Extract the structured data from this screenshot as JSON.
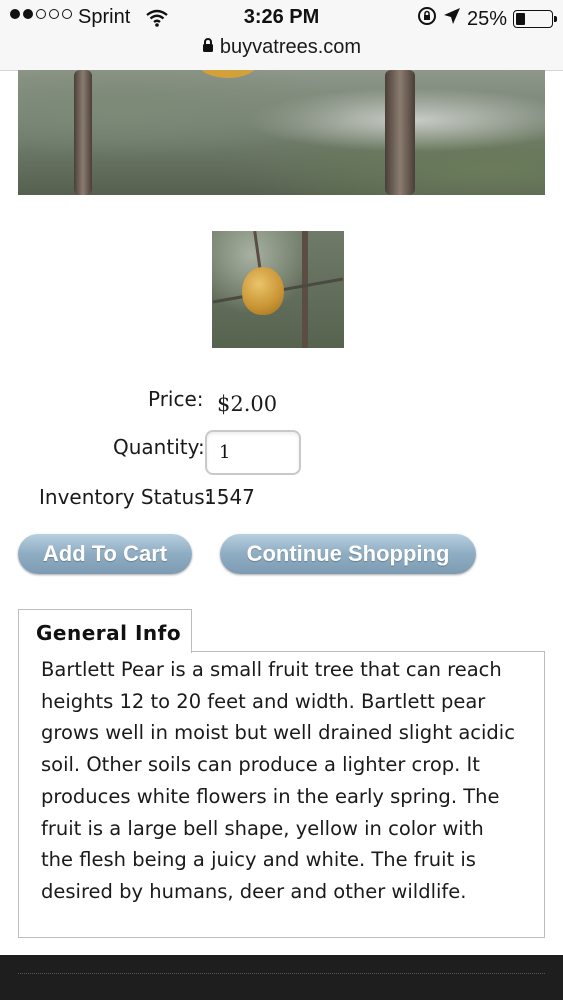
{
  "status_bar": {
    "carrier": "Sprint",
    "time": "3:26 PM",
    "battery_text": "25%",
    "signal_strength": 2
  },
  "address_bar": {
    "domain": "buyvatrees.com"
  },
  "product": {
    "price_label": "Price:",
    "price_value": "$2.00",
    "quantity_label": "Quantity:",
    "quantity_value": "1",
    "inventory_label": "Inventory Status:",
    "inventory_value": "1547"
  },
  "buttons": {
    "add_to_cart": "Add To Cart",
    "continue_shopping": "Continue Shopping"
  },
  "tabs": [
    {
      "label": "General Info",
      "content": "Bartlett Pear is a small fruit tree that can reach heights 12 to 20 feet and width. Bartlett pear grows well in moist but well drained slight acidic soil. Other soils can produce a lighter crop. It produces white flowers in the early spring. The fruit is a large bell shape, yellow in color with the flesh being a juicy and white. The fruit is desired by humans, deer and other wildlife."
    }
  ],
  "icons": {
    "signal": "signal-dots-icon",
    "wifi": "wifi-icon",
    "rotation_lock": "rotation-lock-icon",
    "location": "location-arrow-icon",
    "battery": "battery-icon",
    "lock": "lock-icon"
  },
  "colors": {
    "button_gradient_top": "#b7cfdf",
    "button_gradient_bottom": "#7d9cb3",
    "footer": "#1e1e1e"
  }
}
